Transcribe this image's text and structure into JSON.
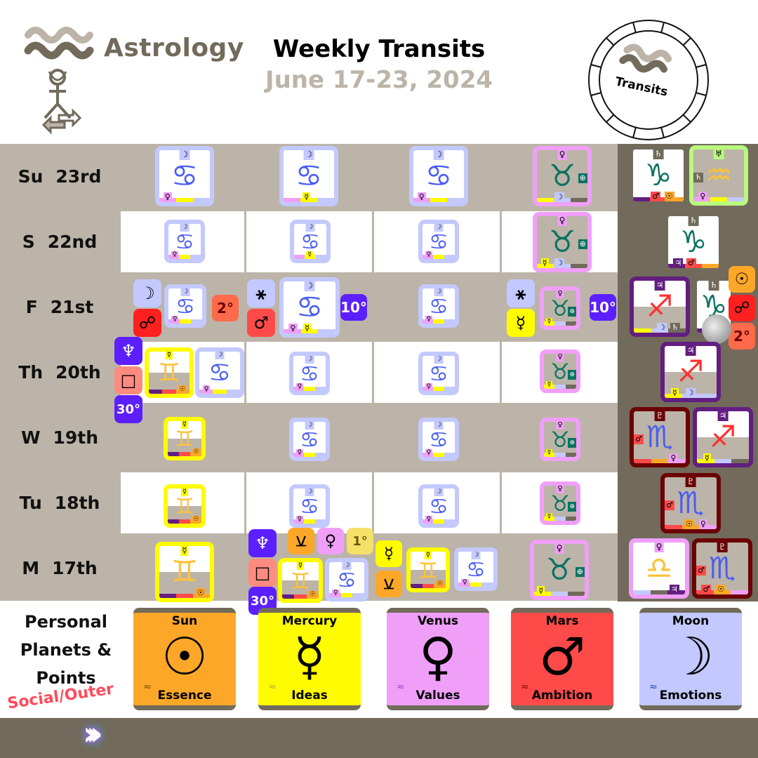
{
  "header": {
    "brand": "Astrology",
    "title": "Weekly Transits",
    "subtitle": "June 17-23, 2024",
    "badge": "Transits"
  },
  "colors": {
    "sun": "#fca728",
    "mercury": "#fffb00",
    "venus": "#f09ff9",
    "mars": "#ff4a4a",
    "moon": "#c3c9ff",
    "jupiter": "#621e80",
    "saturn": "#726a5b",
    "pluto": "#6b0205",
    "neptune": "#5c1fff",
    "uranus": "#b9f97e",
    "tan": "#bcb4a8",
    "cancer_glyph": "#4a5df5",
    "taurus_glyph": "#0b7360",
    "gemini_glyph": "#fcc23a",
    "sagittarius_glyph": "#ff3030"
  },
  "days": [
    {
      "abbr": "Su",
      "date": "23rd"
    },
    {
      "abbr": "S",
      "date": "22nd"
    },
    {
      "abbr": "F",
      "date": "21st"
    },
    {
      "abbr": "Th",
      "date": "20th"
    },
    {
      "abbr": "W",
      "date": "19th"
    },
    {
      "abbr": "Tu",
      "date": "18th"
    },
    {
      "abbr": "M",
      "date": "17th"
    }
  ],
  "glyphs": {
    "cancer": "♋",
    "taurus": "♉",
    "gemini": "♊",
    "capricorn": "♑",
    "aquarius": "♒",
    "sagittarius": "♐",
    "scorpio": "♏",
    "libra": "♎",
    "moon": "☽",
    "venus": "♀",
    "mercury": "☿",
    "mars": "♂",
    "sun": "☉",
    "jupiter": "♃",
    "saturn": "♄",
    "uranus": "♅",
    "pluto": "♇",
    "neptune": "♆",
    "earth": "⊕",
    "opposition": "☍",
    "sextile": "⚹",
    "square": "□",
    "semisextile": "⚺"
  },
  "aspects": {
    "fri_moon_opp_deg": "2°",
    "fri_sextile_mars_deg": "10°",
    "fri_sextile_mercury_deg": "10°",
    "thu_neptune_square_deg": "30°",
    "mon_neptune_square_deg": "30°",
    "mon_venus_deg": "1°",
    "fri_outer_deg": "2°"
  },
  "legend": {
    "heading": "Personal Planets & Points",
    "social": "Social/Outer",
    "cards": [
      {
        "name": "Sun",
        "keyword": "Essence"
      },
      {
        "name": "Mercury",
        "keyword": "Ideas"
      },
      {
        "name": "Venus",
        "keyword": "Values"
      },
      {
        "name": "Mars",
        "keyword": "Ambition"
      },
      {
        "name": "Moon",
        "keyword": "Emotions"
      }
    ]
  }
}
